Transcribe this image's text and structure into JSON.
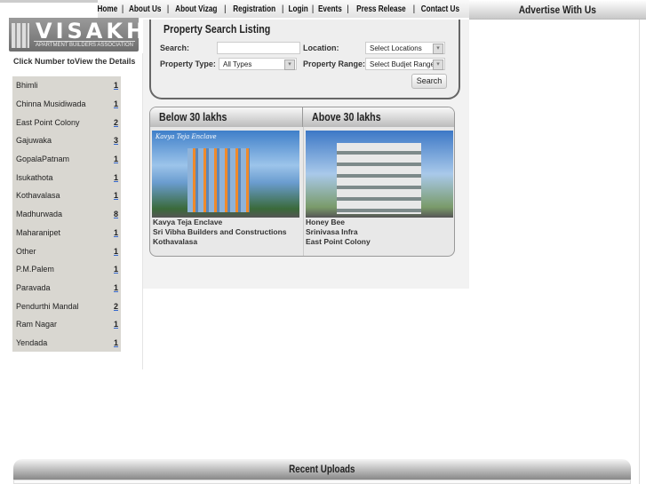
{
  "nav": [
    "Home",
    "About Us",
    "About Vizag",
    "Registration",
    "Login",
    "Events",
    "Press Release",
    "Contact Us"
  ],
  "logo": {
    "title": "VISAKHA",
    "subtitle": "APARTMENT BUILDERS ASSOCIATION"
  },
  "advertise": "Advertise With Us",
  "sidebar": {
    "hint": "Click Number toView the Details",
    "items": [
      {
        "name": "Bhimli",
        "count": "1"
      },
      {
        "name": "Chinna Musidiwada",
        "count": "1"
      },
      {
        "name": "East Point Colony",
        "count": "2"
      },
      {
        "name": "Gajuwaka",
        "count": "3"
      },
      {
        "name": "GopalaPatnam",
        "count": "1"
      },
      {
        "name": "Isukathota",
        "count": "1"
      },
      {
        "name": "Kothavalasa",
        "count": "1"
      },
      {
        "name": "Madhurwada",
        "count": "8"
      },
      {
        "name": "Maharanipet",
        "count": "1"
      },
      {
        "name": "Other",
        "count": "1"
      },
      {
        "name": "P.M.Palem",
        "count": "1"
      },
      {
        "name": "Paravada",
        "count": "1"
      },
      {
        "name": "Pendurthi Mandal",
        "count": "2"
      },
      {
        "name": "Ram Nagar",
        "count": "1"
      },
      {
        "name": "Yendada",
        "count": "1"
      }
    ]
  },
  "search": {
    "title": "Property Search Listing",
    "search_label": "Search:",
    "search_value": "",
    "location_label": "Location:",
    "location_value": "Select Locations",
    "type_label": "Property Type:",
    "type_value": "All Types",
    "range_label": "Property Range:",
    "range_value": "Select Budjet Range",
    "button": "Search"
  },
  "listings": [
    {
      "heading": "Below 30 lakhs",
      "image_caption": "Kavya Teja Enclave",
      "name": "Kavya Teja Enclave",
      "builder": "Sri Vibha Builders and Constructions",
      "location": "Kothavalasa"
    },
    {
      "heading": "Above 30 lakhs",
      "name": "Honey Bee",
      "builder": "Srinivasa Infra",
      "location": "East Point Colony"
    }
  ],
  "recent": "Recent Uploads"
}
